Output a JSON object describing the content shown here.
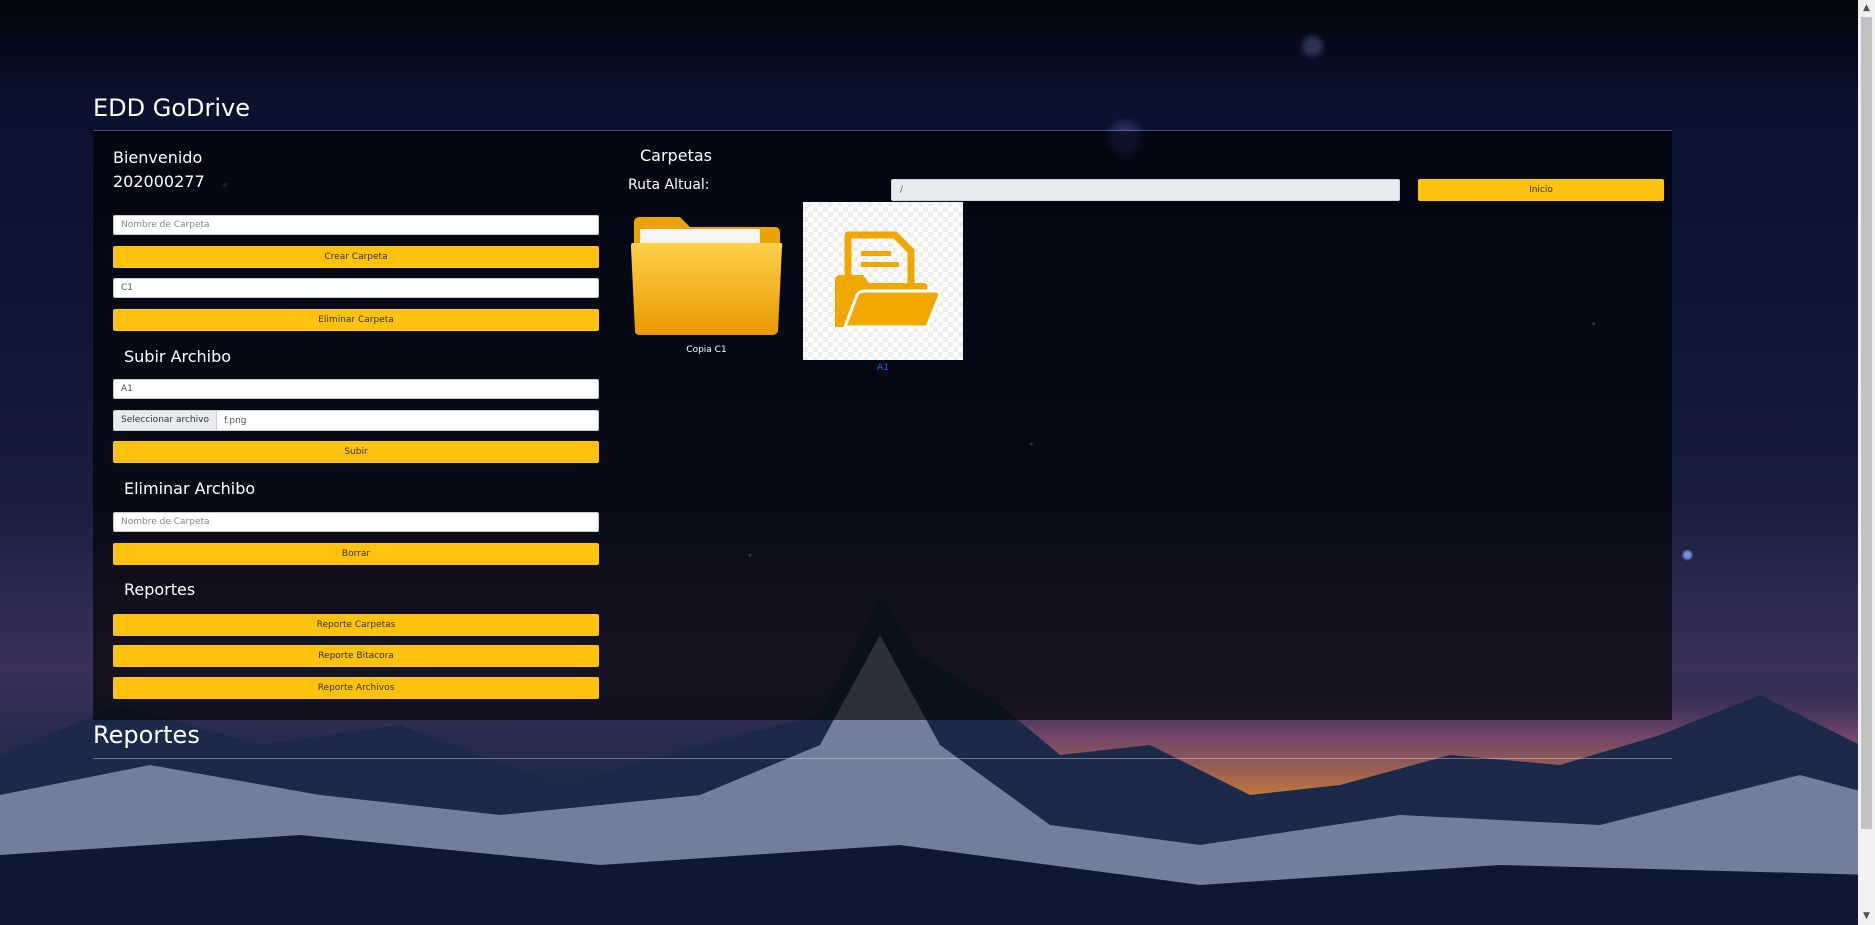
{
  "app": {
    "title": "EDD GoDrive"
  },
  "user": {
    "greeting": "Bienvenido",
    "id": "202000277"
  },
  "folder_form": {
    "name_placeholder": "Nombre de Carpeta",
    "create_label": "Crear Carpeta",
    "delete_value": "C1",
    "delete_label": "Eliminar Carpeta"
  },
  "upload": {
    "heading": "Subir Archibo",
    "name_value": "A1",
    "file_button": "Seleccionar archivo",
    "file_name": "f.png",
    "submit_label": "Subir"
  },
  "delete_file": {
    "heading": "Eliminar Archibo",
    "name_placeholder": "Nombre de Carpeta",
    "submit_label": "Borrar"
  },
  "reports": {
    "heading": "Reportes",
    "buttons": [
      "Reporte Carpetas",
      "Reporte Bitacora",
      "Reporte Archivos"
    ]
  },
  "browser": {
    "heading": "Carpetas",
    "path_label": "Ruta Altual:",
    "path_value": "/",
    "home_label": "Inicio",
    "items": [
      {
        "type": "folder",
        "name": "Copia C1"
      },
      {
        "type": "file",
        "name": "A1"
      }
    ]
  },
  "bottom": {
    "heading": "Reportes"
  },
  "colors": {
    "accent": "#ffc20e",
    "link": "#0d6efd",
    "folder": "#f5b400"
  }
}
